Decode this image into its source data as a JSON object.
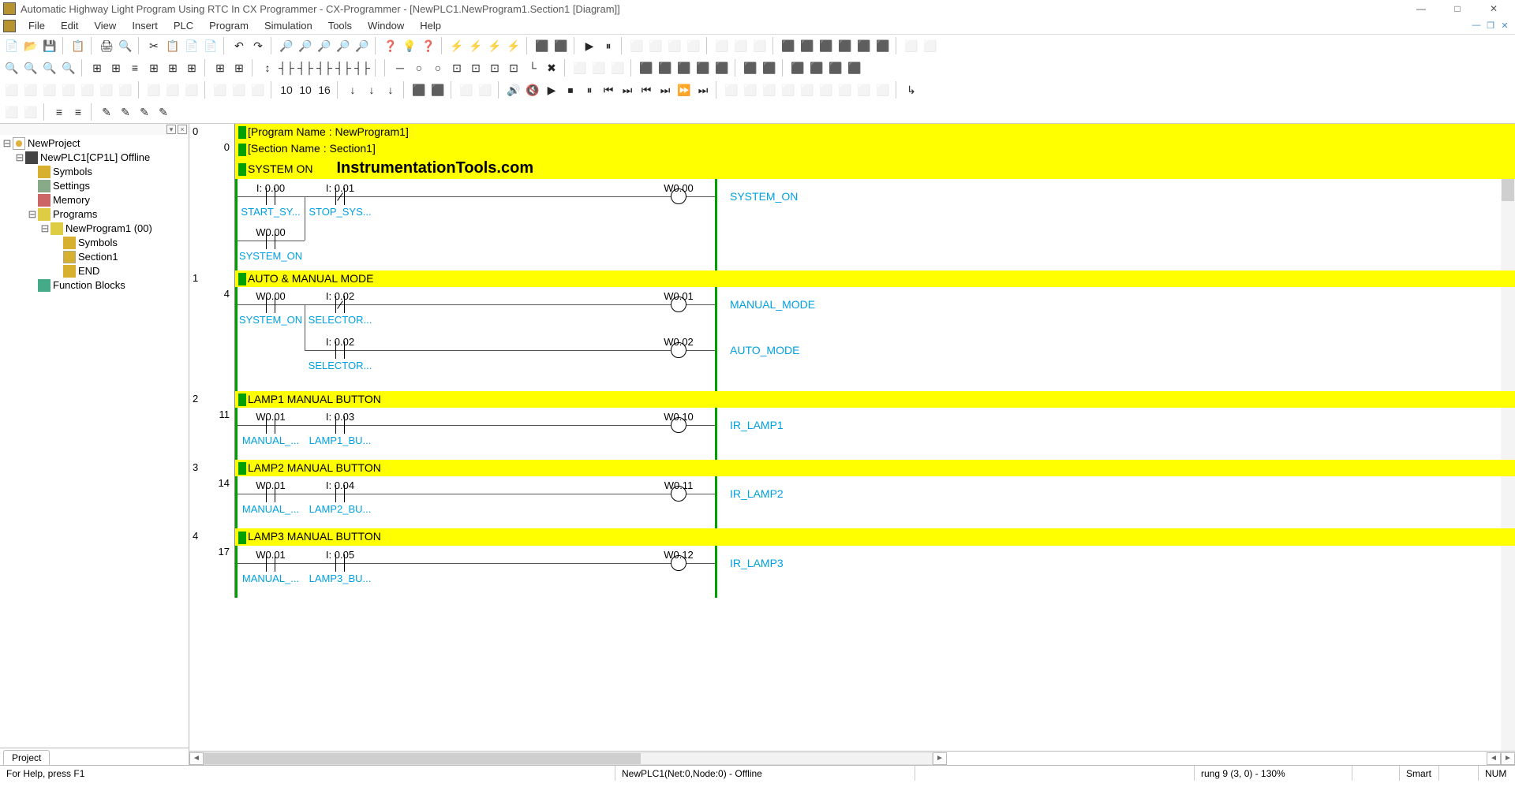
{
  "title": "Automatic Highway Light Program Using RTC In CX Programmer - CX-Programmer - [NewPLC1.NewProgram1.Section1 [Diagram]]",
  "menu": [
    "File",
    "Edit",
    "View",
    "Insert",
    "PLC",
    "Program",
    "Simulation",
    "Tools",
    "Window",
    "Help"
  ],
  "tree": {
    "root": "NewProject",
    "plc": "NewPLC1[CP1L] Offline",
    "symbols": "Symbols",
    "settings": "Settings",
    "memory": "Memory",
    "programs": "Programs",
    "program": "NewProgram1 (00)",
    "psymbols": "Symbols",
    "section": "Section1",
    "end": "END",
    "fb": "Function Blocks"
  },
  "sidetab": "Project",
  "watermark": "InstrumentationTools.com",
  "rungs": [
    {
      "num": "0",
      "step": "0",
      "headers": [
        "[Program Name : NewProgram1]",
        "[Section Name : Section1]",
        "SYSTEM ON"
      ],
      "r0": {
        "c1": {
          "addr": "I: 0.00",
          "tag": "START_SY..."
        },
        "c2": {
          "addr": "I: 0.01",
          "tag": "STOP_SYS..."
        },
        "out": {
          "addr": "W0.00",
          "tag": "SYSTEM_ON"
        }
      },
      "r1": {
        "c1": {
          "addr": "W0.00",
          "tag": "SYSTEM_ON"
        }
      }
    },
    {
      "num": "1",
      "step": "4",
      "headers": [
        "AUTO & MANUAL MODE"
      ],
      "r0": {
        "c1": {
          "addr": "W0.00",
          "tag": "SYSTEM_ON"
        },
        "c2": {
          "addr": "I: 0.02",
          "tag": "SELECTOR..."
        },
        "out": {
          "addr": "W0.01",
          "tag": "MANUAL_MODE"
        }
      },
      "r1": {
        "c2": {
          "addr": "I: 0.02",
          "tag": "SELECTOR..."
        },
        "out": {
          "addr": "W0.02",
          "tag": "AUTO_MODE"
        }
      }
    },
    {
      "num": "2",
      "step": "11",
      "headers": [
        "LAMP1 MANUAL BUTTON"
      ],
      "r0": {
        "c1": {
          "addr": "W0.01",
          "tag": "MANUAL_..."
        },
        "c2": {
          "addr": "I: 0.03",
          "tag": "LAMP1_BU..."
        },
        "out": {
          "addr": "W0.10",
          "tag": "IR_LAMP1"
        }
      }
    },
    {
      "num": "3",
      "step": "14",
      "headers": [
        "LAMP2 MANUAL BUTTON"
      ],
      "r0": {
        "c1": {
          "addr": "W0.01",
          "tag": "MANUAL_..."
        },
        "c2": {
          "addr": "I: 0.04",
          "tag": "LAMP2_BU..."
        },
        "out": {
          "addr": "W0.11",
          "tag": "IR_LAMP2"
        }
      }
    },
    {
      "num": "4",
      "step": "17",
      "headers": [
        "LAMP3 MANUAL BUTTON"
      ],
      "r0": {
        "c1": {
          "addr": "W0.01",
          "tag": "MANUAL_..."
        },
        "c2": {
          "addr": "I: 0.05",
          "tag": "LAMP3_BU..."
        },
        "out": {
          "addr": "W0.12",
          "tag": "IR_LAMP3"
        }
      }
    }
  ],
  "status": {
    "help": "For Help, press F1",
    "net": "NewPLC1(Net:0,Node:0) - Offline",
    "rung": "rung 9 (3, 0)  - 130%",
    "smart": "Smart",
    "num": "NUM"
  },
  "tb": {
    "r1": [
      "📄",
      "📂",
      "💾",
      "│",
      "📋",
      "│",
      "🖨",
      "🔍",
      "│",
      "✂",
      "📋",
      "📄",
      "📄",
      "│",
      "↶",
      "↷",
      "│",
      "🔎",
      "🔎",
      "🔎",
      "🔎",
      "🔎",
      "│",
      "❓",
      "💡",
      "❓",
      "│",
      "⚡",
      "⚡",
      "⚡",
      "⚡",
      "│",
      "⬛",
      "⬛",
      "│",
      "▶",
      "⏸",
      "│",
      "⬜",
      "⬜",
      "⬜",
      "⬜",
      "│",
      "⬜",
      "⬜",
      "⬜",
      "│",
      "⬛",
      "⬛",
      "⬛",
      "⬛",
      "⬛",
      "⬛",
      "│",
      "⬜",
      "⬜"
    ],
    "r2": [
      "🔍",
      "🔍",
      "🔍",
      "🔍",
      "│",
      "⊞",
      "⊞",
      "≡",
      "⊞",
      "⊞",
      "⊞",
      "│",
      "⊞",
      "⊞",
      "│",
      "↕",
      "┤├",
      "┤├",
      "┤├",
      "┤├",
      "┤├",
      "│",
      "│",
      "─",
      "○",
      "○",
      "⊡",
      "⊡",
      "⊡",
      "⊡",
      "└",
      "✖",
      "│",
      "⬜",
      "⬜",
      "⬜",
      "│",
      "⬛",
      "⬛",
      "⬛",
      "⬛",
      "⬛",
      "│",
      "⬛",
      "⬛",
      "│",
      "⬛",
      "⬛",
      "⬛",
      "⬛"
    ],
    "r3": [
      "⬜",
      "⬜",
      "⬜",
      "⬜",
      "⬜",
      "⬜",
      "⬜",
      "│",
      "⬜",
      "⬜",
      "⬜",
      "│",
      "⬜",
      "⬜",
      "⬜",
      "│",
      "10",
      "10",
      "16",
      "│",
      "↓",
      "↓",
      "↓",
      "│",
      "⬛",
      "⬛",
      "│",
      "⬜",
      "⬜",
      "│",
      "🔊",
      "🔇",
      "▶",
      "⏹",
      "⏸",
      "⏮",
      "⏭",
      "⏮",
      "⏭",
      "⏩",
      "⏭",
      "│",
      "⬜",
      "⬜",
      "⬜",
      "⬜",
      "⬜",
      "⬜",
      "⬜",
      "⬜",
      "⬜",
      "│",
      "↳"
    ],
    "r4": [
      "⬜",
      "⬜",
      "│",
      "≡",
      "≡",
      "│",
      "✎",
      "✎",
      "✎",
      "✎"
    ]
  }
}
